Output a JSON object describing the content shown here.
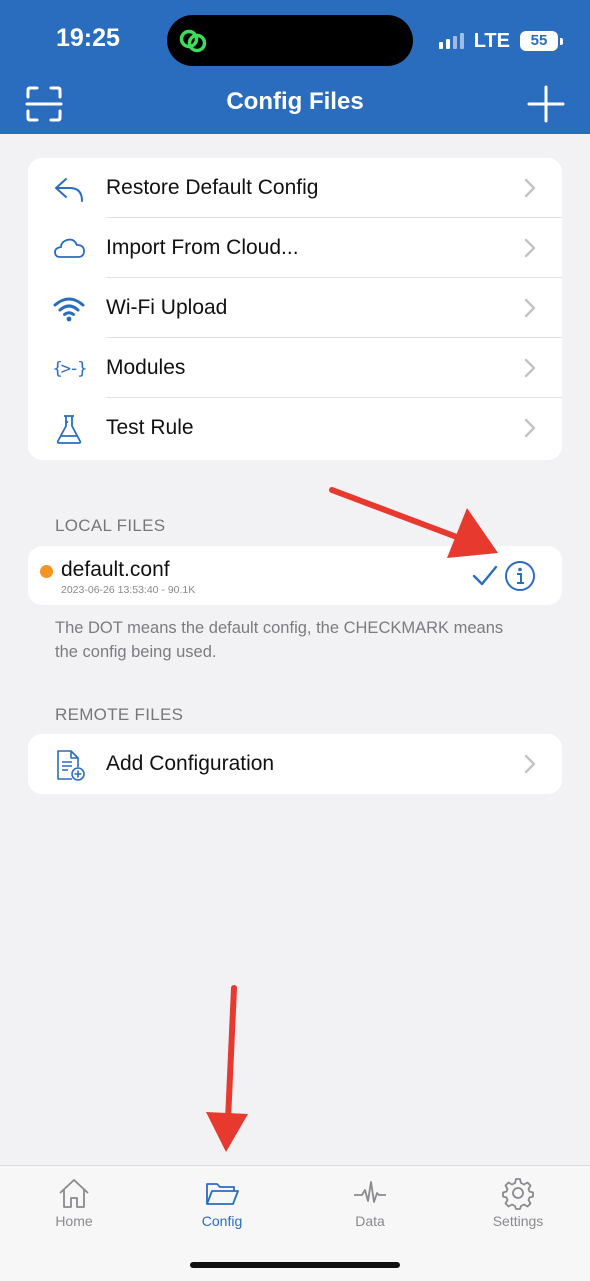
{
  "status_bar": {
    "time": "19:25",
    "network": "LTE",
    "battery": "55"
  },
  "nav": {
    "title": "Config Files",
    "left_icon": "scan-icon",
    "right_icon": "plus-icon"
  },
  "menu": {
    "items": [
      {
        "label": "Restore Default Config",
        "icon": "undo-arrow-icon"
      },
      {
        "label": "Import From Cloud...",
        "icon": "cloud-icon"
      },
      {
        "label": "Wi-Fi Upload",
        "icon": "wifi-icon"
      },
      {
        "label": "Modules",
        "icon": "braces-icon",
        "icon_text": "{>-}"
      },
      {
        "label": "Test Rule",
        "icon": "flask-icon"
      }
    ]
  },
  "local_files": {
    "section_title": "LOCAL FILES",
    "files": [
      {
        "name": "default.conf",
        "meta": "2023-06-26 13:53:40 - 90.1K",
        "is_default": true,
        "in_use": true
      }
    ],
    "footnote": "The DOT means the default config, the CHECKMARK means the config being used."
  },
  "remote_files": {
    "section_title": "REMOTE FILES",
    "items": [
      {
        "label": "Add Configuration",
        "icon": "add-document-icon"
      }
    ]
  },
  "tabbar": {
    "tabs": [
      {
        "label": "Home",
        "icon": "home-icon",
        "active": false
      },
      {
        "label": "Config",
        "icon": "folder-icon",
        "active": true
      },
      {
        "label": "Data",
        "icon": "pulse-icon",
        "active": false
      },
      {
        "label": "Settings",
        "icon": "gear-icon",
        "active": false
      }
    ]
  },
  "colors": {
    "accent": "#2a6dbf",
    "default_dot": "#f5951f",
    "annotation_arrow": "#e8392f"
  }
}
